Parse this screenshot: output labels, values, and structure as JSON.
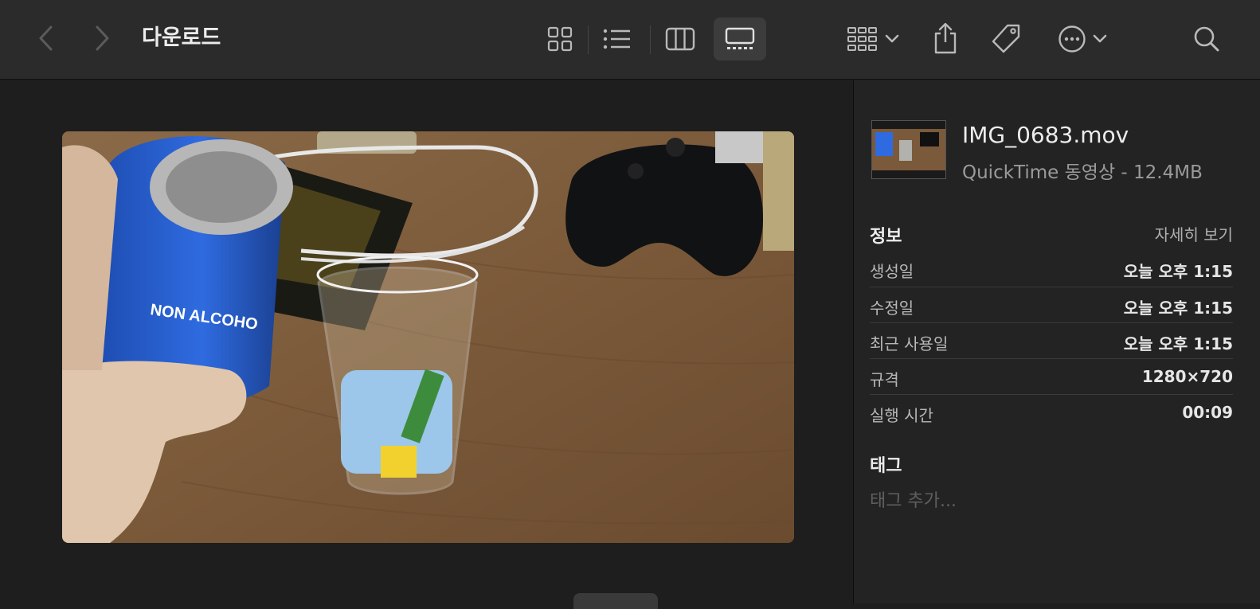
{
  "toolbar": {
    "title": "다운로드",
    "icons": {
      "back": "chevron-left-icon",
      "forward": "chevron-right-icon",
      "icon_view": "grid-view-icon",
      "list_view": "list-view-icon",
      "column_view": "column-view-icon",
      "gallery_view": "gallery-view-icon",
      "group": "group-icon",
      "share": "share-icon",
      "tag": "tag-icon",
      "more": "ellipsis-circle-icon",
      "search": "search-icon"
    }
  },
  "preview": {
    "description_hidden": true
  },
  "file": {
    "name": "IMG_0683.mov",
    "subtitle": "QuickTime 동영상 - 12.4MB"
  },
  "info": {
    "title": "정보",
    "more_link": "자세히 보기",
    "rows": [
      {
        "label": "생성일",
        "value": "오늘 오후 1:15"
      },
      {
        "label": "수정일",
        "value": "오늘 오후 1:15"
      },
      {
        "label": "최근 사용일",
        "value": "오늘 오후 1:15"
      },
      {
        "label": "규격",
        "value": "1280×720"
      },
      {
        "label": "실행 시간",
        "value": "00:09"
      }
    ]
  },
  "tags": {
    "title": "태그",
    "placeholder": "태그 추가..."
  },
  "colors": {
    "toolbar_bg": "#2b2b2b",
    "window_bg": "#1e1e1e",
    "sidebar_bg": "#232323"
  }
}
